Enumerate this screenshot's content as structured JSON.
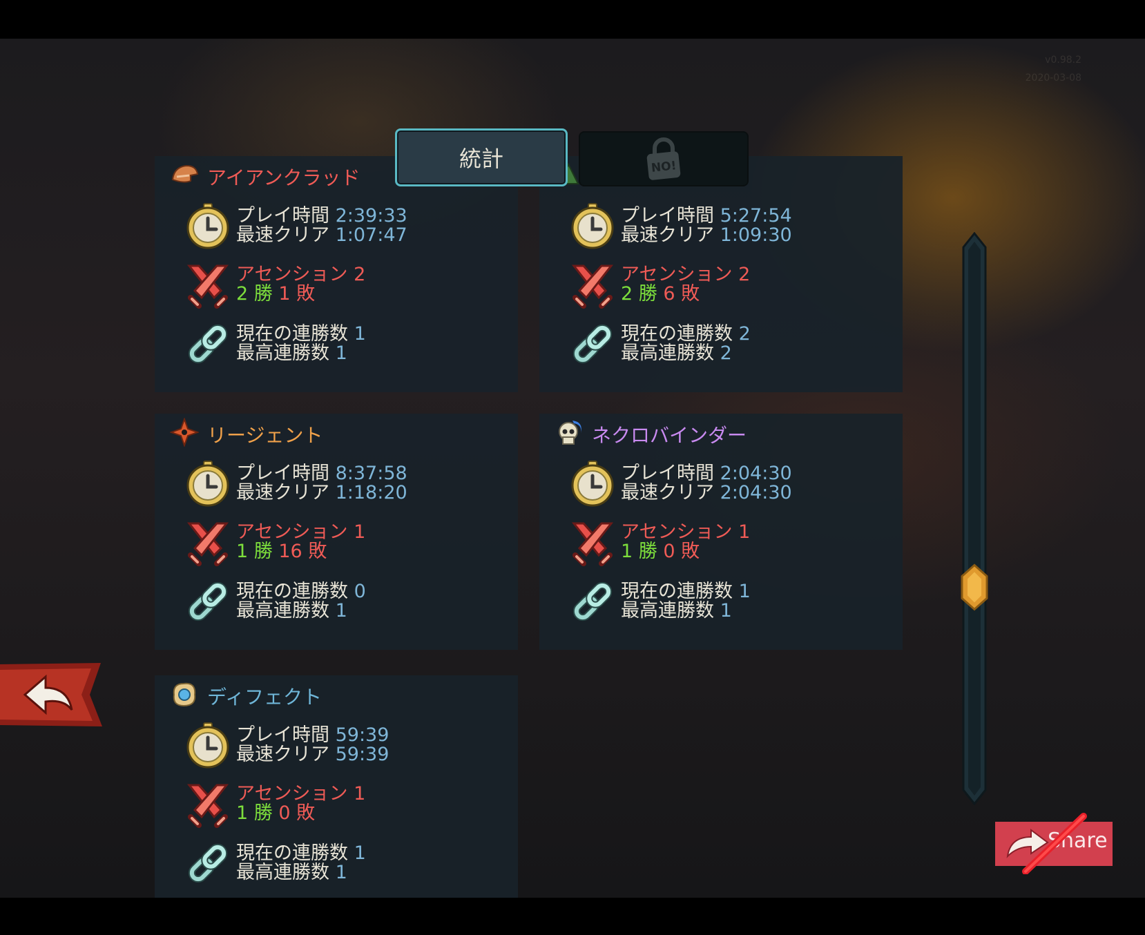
{
  "version": {
    "number": "v0.98.2",
    "date": "2020-03-08"
  },
  "tabs": {
    "stats": "統計",
    "locked": "NO!"
  },
  "labels": {
    "play_time": "プレイ時間",
    "fastest_clear": "最速クリア",
    "ascension": "アセンション",
    "wins_suffix": "勝",
    "losses_suffix": "敗",
    "current_streak": "現在の連勝数",
    "best_streak": "最高連勝数"
  },
  "characters": [
    {
      "name": "アイアンクラッド",
      "name_color": "#ef5b56",
      "icon": "ironclad-helmet-icon",
      "play_time": "2:39:33",
      "fastest_clear": "1:07:47",
      "ascension": "2",
      "wins": "2",
      "losses": "1",
      "current_streak": "1",
      "best_streak": "1"
    },
    {
      "name": "",
      "name_color": "#7dde3c",
      "icon": "silent-icon",
      "play_time": "5:27:54",
      "fastest_clear": "1:09:30",
      "ascension": "2",
      "wins": "2",
      "losses": "6",
      "current_streak": "2",
      "best_streak": "2"
    },
    {
      "name": "リージェント",
      "name_color": "#f0a14a",
      "icon": "regent-star-icon",
      "play_time": "8:37:58",
      "fastest_clear": "1:18:20",
      "ascension": "1",
      "wins": "1",
      "losses": "16",
      "current_streak": "0",
      "best_streak": "1"
    },
    {
      "name": "ネクロバインダー",
      "name_color": "#c88af0",
      "icon": "necrobinder-skull-icon",
      "play_time": "2:04:30",
      "fastest_clear": "2:04:30",
      "ascension": "1",
      "wins": "1",
      "losses": "0",
      "current_streak": "1",
      "best_streak": "1"
    },
    {
      "name": "ディフェクト",
      "name_color": "#6fb6d8",
      "icon": "defect-orb-icon",
      "play_time": "59:39",
      "fastest_clear": "59:39",
      "ascension": "1",
      "wins": "1",
      "losses": "0",
      "current_streak": "1",
      "best_streak": "1"
    }
  ],
  "scrollbar": {
    "position": 0.64
  },
  "buttons": {
    "share": "Share",
    "back_icon": "back-arrow-icon",
    "share_icon": "share-arrow-icon"
  },
  "colors": {
    "value": "#7fb6d8",
    "ascension": "#ef5b56",
    "wins": "#7dde3c",
    "losses": "#ef5b56",
    "tab_border": "#59b9c4"
  }
}
